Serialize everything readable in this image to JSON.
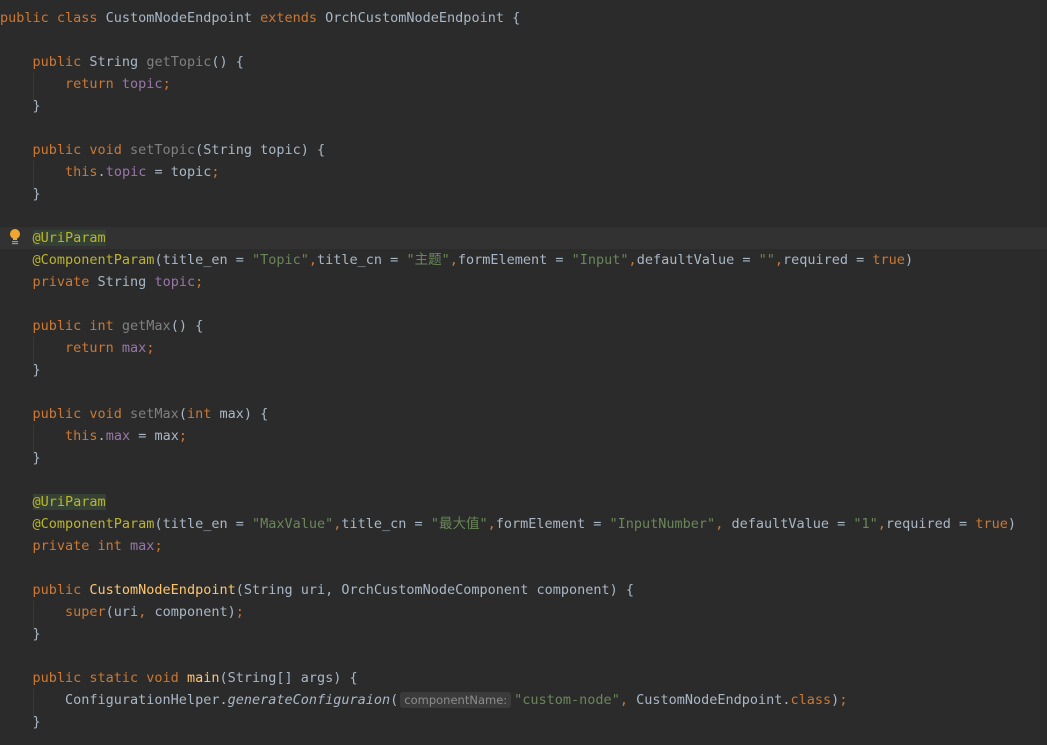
{
  "colors": {
    "background": "#2b2b2b",
    "keyword": "#cc7832",
    "string": "#6a8759",
    "annotation": "#bbb529",
    "field": "#9876aa",
    "method": "#ffc66d"
  },
  "gutter": {
    "intention_icon": "lightbulb-icon"
  },
  "code": {
    "current_line": 10,
    "lines": [
      [
        {
          "text": "public class ",
          "style": "kw"
        },
        {
          "text": "CustomNodeEndpoint ",
          "style": "type"
        },
        {
          "text": "extends ",
          "style": "kw"
        },
        {
          "text": "OrchCustomNodeEndpoint {",
          "style": "type"
        }
      ],
      [],
      [
        {
          "text": "    public ",
          "style": "kw"
        },
        {
          "text": "String ",
          "style": "type"
        },
        {
          "text": "getTopic",
          "style": "unused"
        },
        {
          "text": "() {",
          "style": "plain"
        }
      ],
      [
        {
          "text": "        return ",
          "style": "kw"
        },
        {
          "text": "topic",
          "style": "field"
        },
        {
          "text": ";",
          "style": "kw"
        }
      ],
      [
        {
          "text": "    }",
          "style": "plain"
        }
      ],
      [],
      [
        {
          "text": "    public void ",
          "style": "kw"
        },
        {
          "text": "setTopic",
          "style": "unused"
        },
        {
          "text": "(String topic) {",
          "style": "plain"
        }
      ],
      [
        {
          "text": "        this",
          "style": "kw"
        },
        {
          "text": ".",
          "style": "plain"
        },
        {
          "text": "topic",
          "style": "field"
        },
        {
          "text": " = topic",
          "style": "plain"
        },
        {
          "text": ";",
          "style": "kw"
        }
      ],
      [
        {
          "text": "    }",
          "style": "plain"
        }
      ],
      [],
      [
        {
          "text": "    ",
          "style": "plain"
        },
        {
          "text": "@UriParam",
          "style": "ann-hl"
        }
      ],
      [
        {
          "text": "    @ComponentParam",
          "style": "ann"
        },
        {
          "text": "(title_en = ",
          "style": "plain"
        },
        {
          "text": "\"Topic\"",
          "style": "str"
        },
        {
          "text": ",",
          "style": "kw"
        },
        {
          "text": "title_cn = ",
          "style": "plain"
        },
        {
          "text": "\"主题\"",
          "style": "str"
        },
        {
          "text": ",",
          "style": "kw"
        },
        {
          "text": "formElement = ",
          "style": "plain"
        },
        {
          "text": "\"Input\"",
          "style": "str"
        },
        {
          "text": ",",
          "style": "kw"
        },
        {
          "text": "defaultValue = ",
          "style": "plain"
        },
        {
          "text": "\"\"",
          "style": "str"
        },
        {
          "text": ",",
          "style": "kw"
        },
        {
          "text": "required = ",
          "style": "plain"
        },
        {
          "text": "true",
          "style": "kw"
        },
        {
          "text": ")",
          "style": "plain"
        }
      ],
      [
        {
          "text": "    private ",
          "style": "kw"
        },
        {
          "text": "String ",
          "style": "type"
        },
        {
          "text": "topic",
          "style": "field"
        },
        {
          "text": ";",
          "style": "kw"
        }
      ],
      [],
      [
        {
          "text": "    public int ",
          "style": "kw"
        },
        {
          "text": "getMax",
          "style": "unused"
        },
        {
          "text": "() {",
          "style": "plain"
        }
      ],
      [
        {
          "text": "        return ",
          "style": "kw"
        },
        {
          "text": "max",
          "style": "field"
        },
        {
          "text": ";",
          "style": "kw"
        }
      ],
      [
        {
          "text": "    }",
          "style": "plain"
        }
      ],
      [],
      [
        {
          "text": "    public void ",
          "style": "kw"
        },
        {
          "text": "setMax",
          "style": "unused"
        },
        {
          "text": "(",
          "style": "plain"
        },
        {
          "text": "int ",
          "style": "kw"
        },
        {
          "text": "max) {",
          "style": "plain"
        }
      ],
      [
        {
          "text": "        this",
          "style": "kw"
        },
        {
          "text": ".",
          "style": "plain"
        },
        {
          "text": "max",
          "style": "field"
        },
        {
          "text": " = max",
          "style": "plain"
        },
        {
          "text": ";",
          "style": "kw"
        }
      ],
      [
        {
          "text": "    }",
          "style": "plain"
        }
      ],
      [],
      [
        {
          "text": "    ",
          "style": "plain"
        },
        {
          "text": "@UriParam",
          "style": "ann-hl"
        }
      ],
      [
        {
          "text": "    @ComponentParam",
          "style": "ann"
        },
        {
          "text": "(title_en = ",
          "style": "plain"
        },
        {
          "text": "\"MaxValue\"",
          "style": "str"
        },
        {
          "text": ",",
          "style": "kw"
        },
        {
          "text": "title_cn = ",
          "style": "plain"
        },
        {
          "text": "\"最大值\"",
          "style": "str"
        },
        {
          "text": ",",
          "style": "kw"
        },
        {
          "text": "formElement = ",
          "style": "plain"
        },
        {
          "text": "\"InputNumber\"",
          "style": "str"
        },
        {
          "text": ", ",
          "style": "kw"
        },
        {
          "text": "defaultValue = ",
          "style": "plain"
        },
        {
          "text": "\"1\"",
          "style": "str"
        },
        {
          "text": ",",
          "style": "kw"
        },
        {
          "text": "required = ",
          "style": "plain"
        },
        {
          "text": "true",
          "style": "kw"
        },
        {
          "text": ")",
          "style": "plain"
        }
      ],
      [
        {
          "text": "    private int ",
          "style": "kw"
        },
        {
          "text": "max",
          "style": "field"
        },
        {
          "text": ";",
          "style": "kw"
        }
      ],
      [],
      [
        {
          "text": "    public ",
          "style": "kw"
        },
        {
          "text": "CustomNodeEndpoint",
          "style": "method"
        },
        {
          "text": "(String uri, OrchCustomNodeComponent component) {",
          "style": "plain"
        }
      ],
      [
        {
          "text": "        super",
          "style": "kw"
        },
        {
          "text": "(uri",
          "style": "plain"
        },
        {
          "text": ", ",
          "style": "kw"
        },
        {
          "text": "component)",
          "style": "plain"
        },
        {
          "text": ";",
          "style": "kw"
        }
      ],
      [
        {
          "text": "    }",
          "style": "plain"
        }
      ],
      [],
      [
        {
          "text": "    public static void ",
          "style": "kw"
        },
        {
          "text": "main",
          "style": "method"
        },
        {
          "text": "(String[] args) {",
          "style": "plain"
        }
      ],
      [
        {
          "text": "        ConfigurationHelper.",
          "style": "plain"
        },
        {
          "text": "generateConfiguraion",
          "style": "italic"
        },
        {
          "text": "(",
          "style": "plain"
        },
        {
          "text": "componentName:",
          "style": "hint"
        },
        {
          "text": "\"custom-node\"",
          "style": "str"
        },
        {
          "text": ", ",
          "style": "kw"
        },
        {
          "text": "CustomNodeEndpoint.",
          "style": "plain"
        },
        {
          "text": "class",
          "style": "kw"
        },
        {
          "text": ")",
          "style": "plain"
        },
        {
          "text": ";",
          "style": "kw"
        }
      ],
      [
        {
          "text": "    }",
          "style": "plain"
        }
      ]
    ]
  }
}
